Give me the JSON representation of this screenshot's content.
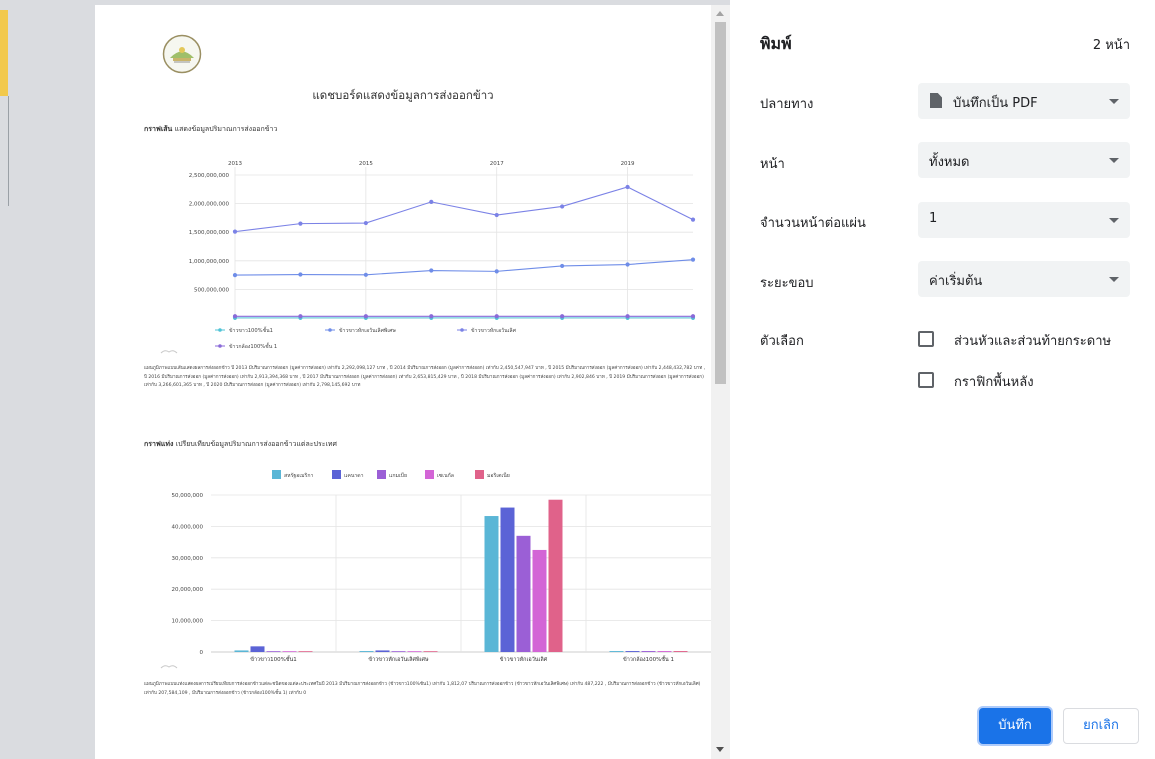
{
  "preview": {
    "doc_title": "แดชบอร์ดแสดงข้อมูลการส่งออกข้าว",
    "line_section": {
      "title_bold": "กราฟเส้น",
      "title_rest": "แสดงข้อมูลปริมาณการส่งออกข้าว",
      "description": "แผนภูมิภาพแบบเส้นแสดงผลการส่งออกข้าว ปี 2013 มีปริมาณการส่งออก (มูลค่าการส่งออก) เท่ากับ 2,292,098,127 บาท , ปี 2014 มีปริมาณการส่งออก (มูลค่าการส่งออก) เท่ากับ 2,450,547,947 บาท , ปี 2015 มีปริมาณการส่งออก (มูลค่าการส่งออก) เท่ากับ 2,448,432,782 บาท , ปี 2016 มีปริมาณการส่งออก (มูลค่าการส่งออก) เท่ากับ 2,913,394,368 บาท , ปี 2017 มีปริมาณการส่งออก (มูลค่าการส่งออก) เท่ากับ 2,653,815,429 บาท , ปี 2018 มีปริมาณการส่งออก (มูลค่าการส่งออก) เท่ากับ 2,902,846 บาท , ปี 2019 มีปริมาณการส่งออก (มูลค่าการส่งออก) เท่ากับ 3,266,601,365 บาท , ปี 2020 มีปริมาณการส่งออก (มูลค่าการส่งออก) เท่ากับ 2,798,145,692 บาท"
    },
    "bar_section": {
      "title_bold": "กราฟแท่ง",
      "title_rest": "เปรียบเทียบข้อมูลปริมาณการส่งออกข้าวแต่ละประเทศ",
      "description": "แผนภูมิภาพแบบแท่งแสดงผลการเปรียบเทียบการส่งออกข้าวแต่ละชนิดของแต่ละประเทศในปี 2013 มีปริมาณการส่งออกข้าว (ข้าวขาว100%ชั้น1) เท่ากับ 1,812,07 ปริมาณการส่งออกข้าว (ข้าวขาวหักเอวันเลิศพิเศษ) เท่ากับ 487,222 , มีปริมาณการส่งออกข้าว (ข้าวขาวหักเอวันเลิศ) เท่ากับ 207,584,109 , มีปริมาณการส่งออกข้าว (ข้าวกล้อง100%ชั้น 1) เท่ากับ 0"
    }
  },
  "chart_data": [
    {
      "type": "line",
      "x": [
        2013,
        2014,
        2015,
        2016,
        2017,
        2018,
        2019,
        2020
      ],
      "x_tick_labels": [
        "2013",
        "2015",
        "2017",
        "2019"
      ],
      "ylim": [
        0,
        2500000000
      ],
      "y_tick_labels": [
        "2,500,000,000",
        "2,000,000,000",
        "1,500,000,000",
        "1,000,000,000",
        "500,000,000"
      ],
      "grid": true,
      "legend": "bottom",
      "series": [
        {
          "name": "ข้าวขาว100%ชั้น1",
          "color": "#4fc3d6",
          "values": [
            2000000,
            2000000,
            2000000,
            2000000,
            2000000,
            2000000,
            2000000,
            2000000
          ]
        },
        {
          "name": "ข้าวขาวหักเอวันเลิศพิเศษ",
          "color": "#6f8de8",
          "values": [
            750000000,
            760000000,
            755000000,
            830000000,
            815000000,
            910000000,
            935000000,
            1020000000
          ]
        },
        {
          "name": "ข้าวขาวหักเอวันเลิศ",
          "color": "#7b82e6",
          "values": [
            1510000000,
            1650000000,
            1660000000,
            2030000000,
            1800000000,
            1950000000,
            2290000000,
            1720000000
          ]
        },
        {
          "name": "ข้าวกล้อง100%ชั้น 1",
          "color": "#8a6ad8",
          "values": [
            30000000,
            30000000,
            30000000,
            30000000,
            30000000,
            30000000,
            30000000,
            30000000
          ]
        }
      ]
    },
    {
      "type": "bar",
      "categories": [
        "ข้าวขาว100%ชั้น1",
        "ข้าวขาวหักเอวันเลิศพิเศษ",
        "ข้าวขาวหักเอวันเลิศ",
        "ข้าวกล้อง100%ชั้น 1"
      ],
      "ylim": [
        0,
        50000000
      ],
      "y_tick_labels": [
        "50,000,000",
        "40,000,000",
        "30,000,000",
        "20,000,000",
        "10,000,000",
        "0"
      ],
      "grid": true,
      "legend": "top",
      "series": [
        {
          "name": "สหรัฐอเมริกา",
          "color": "#5ab6d6",
          "values": [
            500000,
            300000,
            43300000,
            300000
          ]
        },
        {
          "name": "แคนาดา",
          "color": "#5b63d6",
          "values": [
            1800000,
            500000,
            46000000,
            300000
          ]
        },
        {
          "name": "แกมเบีย",
          "color": "#9b5fd6",
          "values": [
            200000,
            200000,
            37000000,
            300000
          ]
        },
        {
          "name": "เซเนกัล",
          "color": "#d365d6",
          "values": [
            200000,
            200000,
            32500000,
            300000
          ]
        },
        {
          "name": "มอริเตเนีย",
          "color": "#e0628a",
          "values": [
            200000,
            200000,
            48500000,
            300000
          ]
        }
      ]
    }
  ],
  "panel": {
    "title": "พิมพ์",
    "page_count": "2 หน้า",
    "destination": {
      "label": "ปลายทาง",
      "value": "บันทึกเป็น PDF",
      "icon": "file-icon"
    },
    "pages": {
      "label": "หน้า",
      "value": "ทั้งหมด"
    },
    "pages_per_sheet": {
      "label": "จำนวนหน้าต่อแผ่น",
      "value": "1"
    },
    "margins": {
      "label": "ระยะขอบ",
      "value": "ค่าเริ่มต้น"
    },
    "options": {
      "label": "ตัวเลือก",
      "headers_footers": "ส่วนหัวและส่วนท้ายกระดาษ",
      "background_graphics": "กราฟิกพื้นหลัง"
    },
    "save_label": "บันทึก",
    "cancel_label": "ยกเลิก"
  },
  "colors": {
    "accent": "#1a73e8",
    "select_bg": "#f1f3f4",
    "preview_bg": "#dadce0"
  }
}
